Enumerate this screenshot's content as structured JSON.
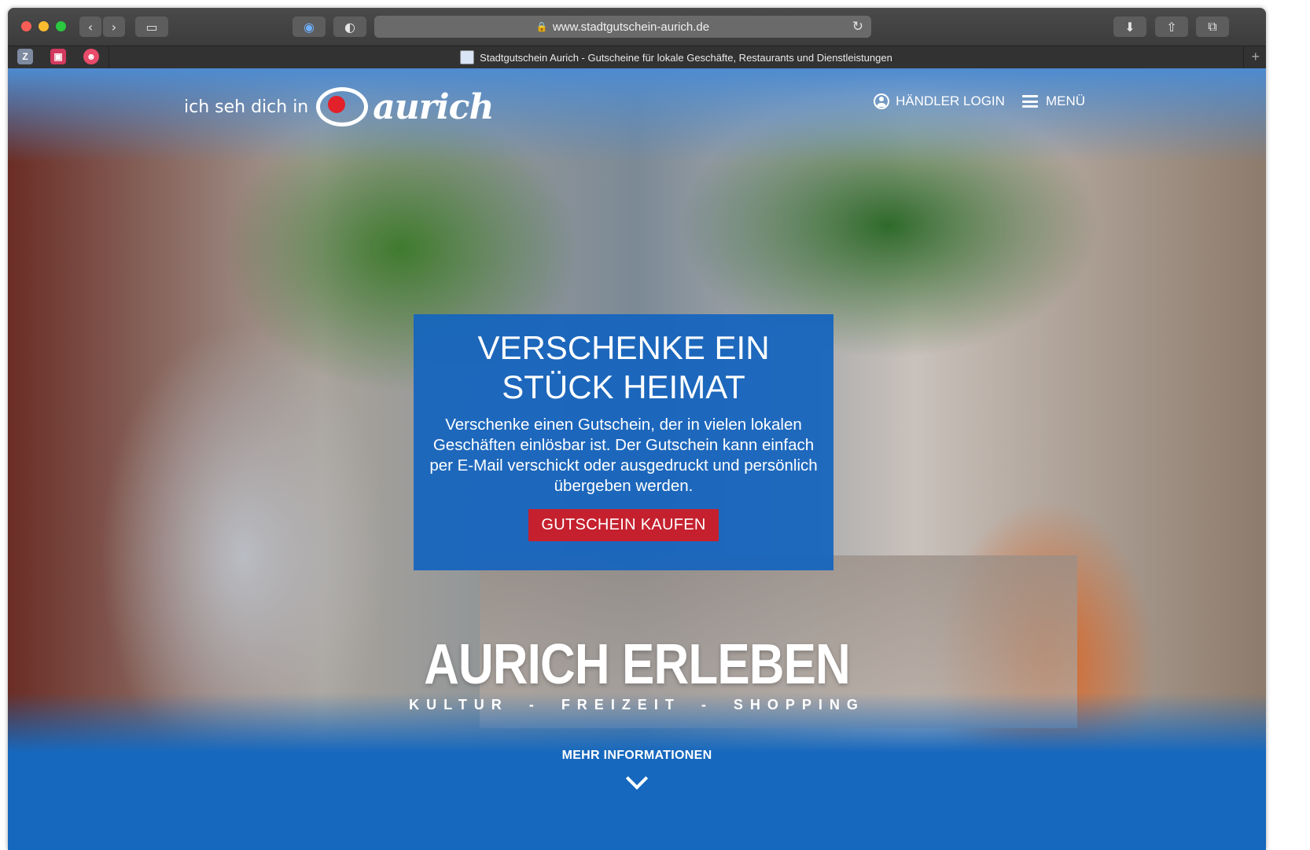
{
  "browser": {
    "url": "www.stadtgutschein-aurich.de",
    "tab_title": "Stadtgutschein Aurich - Gutscheine für lokale Geschäfte, Restaurants und Dienstleistungen",
    "pinned_tabs": [
      "Z",
      "",
      ""
    ]
  },
  "header": {
    "logo_tagline": "ich seh dich in",
    "logo_word": "aurich",
    "nav": {
      "login_label": "HÄNDLER LOGIN",
      "menu_label": "MENÜ"
    }
  },
  "hero": {
    "title_line1": "VERSCHENKE EIN",
    "title_line2": "STÜCK HEIMAT",
    "text": "Verschenke einen Gutschein, der in vielen lokalen Geschäften einlösbar ist. Der Gutschein kann einfach per E-Mail verschickt oder ausgedruckt und persönlich übergeben werden.",
    "cta_label": "GUTSCHEIN KAUFEN"
  },
  "banner": {
    "title": "AURICH ERLEBEN",
    "sub1": "KULTUR",
    "sep1": "-",
    "sub2": "FREIZEIT",
    "sep2": "-",
    "sub3": "SHOPPING"
  },
  "more": {
    "label": "MEHR INFORMATIONEN"
  },
  "colors": {
    "brand_blue": "#1668be",
    "cta_red": "#c5202e"
  }
}
